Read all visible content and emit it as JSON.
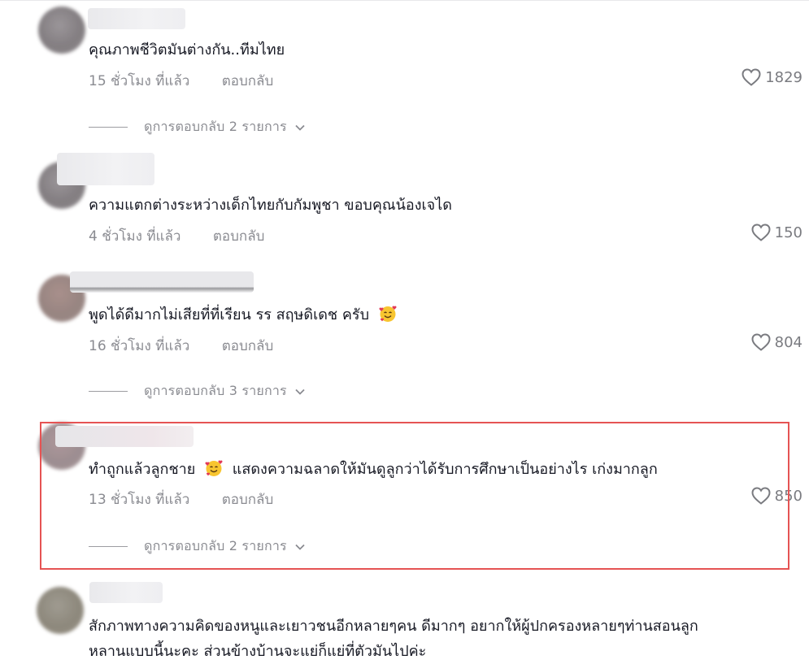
{
  "comments": [
    {
      "text": "คุณภาพชีวิตมันต่างกัน..ทีมไทย",
      "time": "15 ชั่วโมง ที่แล้ว",
      "reply": "ตอบกลับ",
      "likes": "1829",
      "replies": "ดูการตอบกลับ 2 รายการ"
    },
    {
      "text": "ความแตกต่างระหว่างเด็กไทยกับกัมพูชา ขอบคุณน้องเจได",
      "time": "4 ชั่วโมง ที่แล้ว",
      "reply": "ตอบกลับ",
      "likes": "150"
    },
    {
      "text": "พูดได้ดีมากไม่เสียที่ที่เรียน รร สฤษดิเดช ครับ",
      "emoji": "smiling-face-with-hearts",
      "time": "16 ชั่วโมง ที่แล้ว",
      "reply": "ตอบกลับ",
      "likes": "804",
      "replies": "ดูการตอบกลับ 3 รายการ"
    },
    {
      "text_before": "ทำถูกแล้วลูกชาย",
      "emoji": "smiling-face-with-hearts",
      "text_after": "แสดงความฉลาดให้มันดูลูกว่าได้รับการศึกษาเป็นอย่างไร เก่งมากลูก",
      "time": "13 ชั่วโมง ที่แล้ว",
      "reply": "ตอบกลับ",
      "likes": "850",
      "replies": "ดูการตอบกลับ 2 รายการ"
    },
    {
      "text_line1": "สักภาพทางความคิดของหนูและเยาวชนอีกหลายๆคน ดีมากๆ อยากให้ผู้ปกครองหลายๆท่านสอนลูก",
      "text_line2": "หลานแบบนี้นะคะ ส่วนข้างบ้านจะแย่ก็แย่ที่ตัวมันไปค่ะ"
    }
  ],
  "colors": {
    "text": "#161823",
    "meta": "#8a8b91",
    "highlight_border": "#e55353"
  }
}
